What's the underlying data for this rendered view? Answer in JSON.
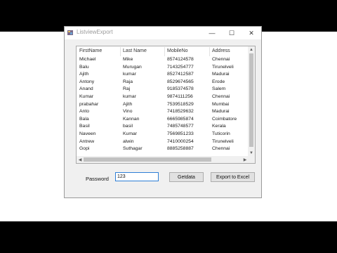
{
  "window": {
    "title": "ListviewExport",
    "controls": {
      "minimize": "—",
      "maximize": "☐",
      "close": "✕"
    }
  },
  "listview": {
    "columns": [
      "FirstName",
      "Last Name",
      "MobileNo",
      "Address"
    ],
    "rows": [
      [
        "Michael",
        "Mike",
        "8574124578",
        "Chennai"
      ],
      [
        "Balu",
        "Murugan",
        "7143254777",
        "Tirunelveli"
      ],
      [
        "Ajith",
        "kumar",
        "8527412587",
        "Madurai"
      ],
      [
        "Antony",
        "Raja",
        "8529674565",
        "Erode"
      ],
      [
        "Anand",
        "Raj",
        "9185374578",
        "Salem"
      ],
      [
        "Kumar",
        "kumar",
        "9874111256",
        "Chennai"
      ],
      [
        "prabahar",
        "Ajith",
        "7539518529",
        "Mumbai"
      ],
      [
        "Anto",
        "Vino",
        "7418529632",
        "Madurai"
      ],
      [
        "Bala",
        "Kannan",
        "6665985874",
        "Coimbatore"
      ],
      [
        "Basil",
        "basil",
        "7485748577",
        "Kerala"
      ],
      [
        "Naveen",
        "Kumar",
        "7569851233",
        "Tuticorin"
      ],
      [
        "Antrew",
        "alwin",
        "7410000254",
        "Tirunelveli"
      ],
      [
        "Gopi",
        "Suthagar",
        "8885258887",
        "Chennai"
      ]
    ]
  },
  "form": {
    "password_label": "Password",
    "password_value": "123",
    "getdata_label": "Getdata",
    "export_label": "Export to Excel"
  }
}
